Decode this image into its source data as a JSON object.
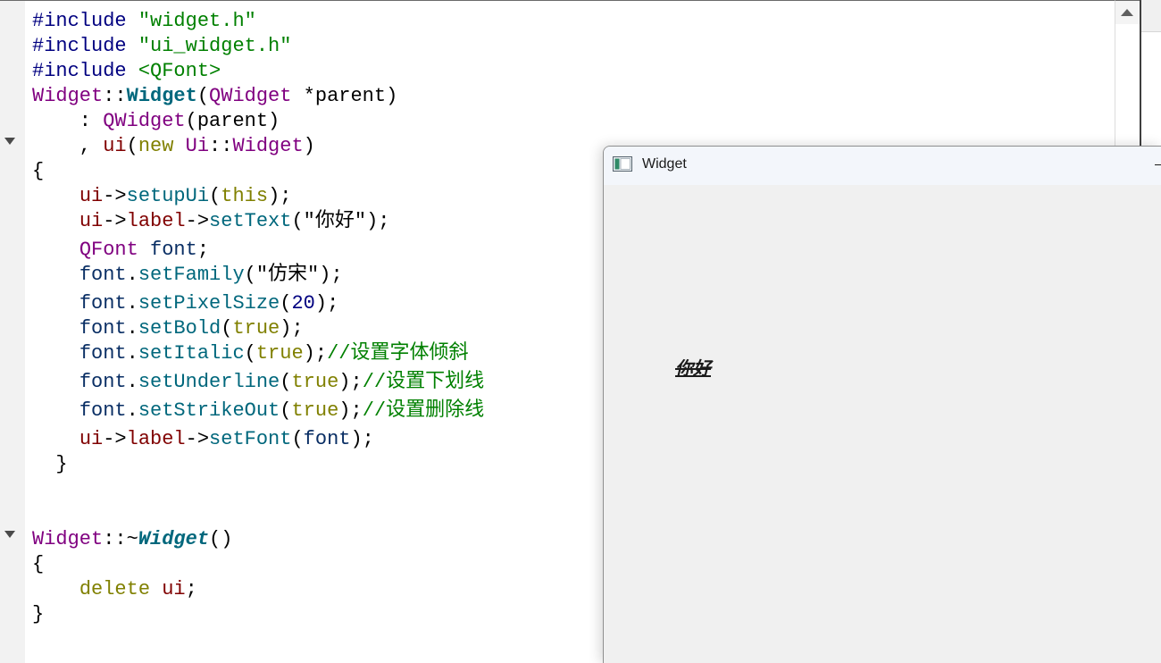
{
  "editor": {
    "lines": [
      [
        {
          "t": "#include ",
          "c": "#000080"
        },
        {
          "t": "\"widget.h\"",
          "c": "#008000"
        }
      ],
      [
        {
          "t": "#include ",
          "c": "#000080"
        },
        {
          "t": "\"ui_widget.h\"",
          "c": "#008000"
        }
      ],
      [
        {
          "t": "#include ",
          "c": "#000080"
        },
        {
          "t": "<QFont>",
          "c": "#008000"
        }
      ],
      [
        {
          "t": "Widget",
          "c": "#800080"
        },
        {
          "t": "::",
          "c": "#000000"
        },
        {
          "t": "Widget",
          "c": "#00677c",
          "bold": true
        },
        {
          "t": "(",
          "c": "#000000"
        },
        {
          "t": "QWidget",
          "c": "#800080"
        },
        {
          "t": " *parent)",
          "c": "#000000"
        }
      ],
      [
        {
          "t": "    : ",
          "c": "#000000"
        },
        {
          "t": "QWidget",
          "c": "#800080"
        },
        {
          "t": "(parent)",
          "c": "#000000"
        }
      ],
      [
        {
          "t": "    , ",
          "c": "#000000"
        },
        {
          "t": "ui",
          "c": "#800000"
        },
        {
          "t": "(",
          "c": "#000000"
        },
        {
          "t": "new",
          "c": "#808000"
        },
        {
          "t": " ",
          "c": "#000000"
        },
        {
          "t": "Ui",
          "c": "#800080"
        },
        {
          "t": "::",
          "c": "#000000"
        },
        {
          "t": "Widget",
          "c": "#800080"
        },
        {
          "t": ")",
          "c": "#000000"
        }
      ],
      [
        {
          "t": "{",
          "c": "#000000"
        }
      ],
      [
        {
          "t": "    ",
          "c": "#000000"
        },
        {
          "t": "ui",
          "c": "#800000"
        },
        {
          "t": "->",
          "c": "#000000"
        },
        {
          "t": "setupUi",
          "c": "#00677c"
        },
        {
          "t": "(",
          "c": "#000000"
        },
        {
          "t": "this",
          "c": "#808000"
        },
        {
          "t": ");",
          "c": "#000000"
        }
      ],
      [
        {
          "t": "    ",
          "c": "#000000"
        },
        {
          "t": "ui",
          "c": "#800000"
        },
        {
          "t": "->",
          "c": "#000000"
        },
        {
          "t": "label",
          "c": "#800000"
        },
        {
          "t": "->",
          "c": "#000000"
        },
        {
          "t": "setText",
          "c": "#00677c"
        },
        {
          "t": "(\"你好\");",
          "c": "#000000"
        }
      ],
      [
        {
          "t": "    ",
          "c": "#000000"
        },
        {
          "t": "QFont",
          "c": "#800080"
        },
        {
          "t": " ",
          "c": "#000000"
        },
        {
          "t": "font",
          "c": "#092e64"
        },
        {
          "t": ";",
          "c": "#000000"
        }
      ],
      [
        {
          "t": "    ",
          "c": "#000000"
        },
        {
          "t": "font",
          "c": "#092e64"
        },
        {
          "t": ".",
          "c": "#000000"
        },
        {
          "t": "setFamily",
          "c": "#00677c"
        },
        {
          "t": "(\"仿宋\");",
          "c": "#000000"
        }
      ],
      [
        {
          "t": "    ",
          "c": "#000000"
        },
        {
          "t": "font",
          "c": "#092e64"
        },
        {
          "t": ".",
          "c": "#000000"
        },
        {
          "t": "setPixelSize",
          "c": "#00677c"
        },
        {
          "t": "(",
          "c": "#000000"
        },
        {
          "t": "20",
          "c": "#000080"
        },
        {
          "t": ");",
          "c": "#000000"
        }
      ],
      [
        {
          "t": "    ",
          "c": "#000000"
        },
        {
          "t": "font",
          "c": "#092e64"
        },
        {
          "t": ".",
          "c": "#000000"
        },
        {
          "t": "setBold",
          "c": "#00677c"
        },
        {
          "t": "(",
          "c": "#000000"
        },
        {
          "t": "true",
          "c": "#808000"
        },
        {
          "t": ");",
          "c": "#000000"
        }
      ],
      [
        {
          "t": "    ",
          "c": "#000000"
        },
        {
          "t": "font",
          "c": "#092e64"
        },
        {
          "t": ".",
          "c": "#000000"
        },
        {
          "t": "setItalic",
          "c": "#00677c"
        },
        {
          "t": "(",
          "c": "#000000"
        },
        {
          "t": "true",
          "c": "#808000"
        },
        {
          "t": ");",
          "c": "#000000"
        },
        {
          "t": "//设置字体倾斜",
          "c": "#008000"
        }
      ],
      [
        {
          "t": "    ",
          "c": "#000000"
        },
        {
          "t": "font",
          "c": "#092e64"
        },
        {
          "t": ".",
          "c": "#000000"
        },
        {
          "t": "setUnderline",
          "c": "#00677c"
        },
        {
          "t": "(",
          "c": "#000000"
        },
        {
          "t": "true",
          "c": "#808000"
        },
        {
          "t": ");",
          "c": "#000000"
        },
        {
          "t": "//设置下划线",
          "c": "#008000"
        }
      ],
      [
        {
          "t": "    ",
          "c": "#000000"
        },
        {
          "t": "font",
          "c": "#092e64"
        },
        {
          "t": ".",
          "c": "#000000"
        },
        {
          "t": "setStrikeOut",
          "c": "#00677c"
        },
        {
          "t": "(",
          "c": "#000000"
        },
        {
          "t": "true",
          "c": "#808000"
        },
        {
          "t": ");",
          "c": "#000000"
        },
        {
          "t": "//设置删除线",
          "c": "#008000"
        }
      ],
      [
        {
          "t": "    ",
          "c": "#000000"
        },
        {
          "t": "ui",
          "c": "#800000"
        },
        {
          "t": "->",
          "c": "#000000"
        },
        {
          "t": "label",
          "c": "#800000"
        },
        {
          "t": "->",
          "c": "#000000"
        },
        {
          "t": "setFont",
          "c": "#00677c"
        },
        {
          "t": "(",
          "c": "#000000"
        },
        {
          "t": "font",
          "c": "#092e64"
        },
        {
          "t": ");",
          "c": "#000000"
        }
      ],
      [
        {
          "t": "  }",
          "c": "#000000"
        }
      ],
      [],
      [],
      [
        {
          "t": "Widget",
          "c": "#800080"
        },
        {
          "t": "::~",
          "c": "#000000"
        },
        {
          "t": "Widget",
          "c": "#00677c",
          "bold": true,
          "italic": true
        },
        {
          "t": "()",
          "c": "#000000"
        }
      ],
      [
        {
          "t": "{",
          "c": "#000000"
        }
      ],
      [
        {
          "t": "    ",
          "c": "#000000"
        },
        {
          "t": "delete",
          "c": "#808000"
        },
        {
          "t": " ",
          "c": "#000000"
        },
        {
          "t": "ui",
          "c": "#800000"
        },
        {
          "t": ";",
          "c": "#000000"
        }
      ],
      [
        {
          "t": "}",
          "c": "#000000"
        }
      ]
    ]
  },
  "window": {
    "title": "Widget",
    "label_text": "你好"
  },
  "colors": {
    "editor_bg": "#ffffff",
    "gutter_bg": "#f2f2f2",
    "titlebar_bg": "#f3f6fb",
    "client_bg": "#f0f0f0"
  }
}
